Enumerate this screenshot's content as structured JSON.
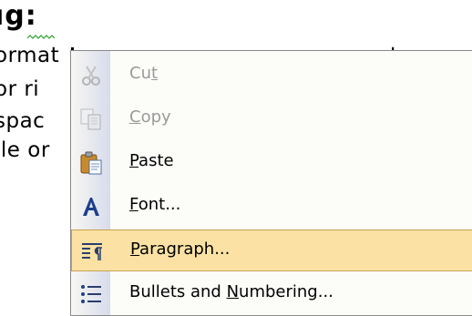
{
  "document": {
    "heading": "ıg:",
    "lines": [
      "ormat",
      "or ri",
      "spac",
      "jle or"
    ],
    "edge_glyphs": [
      "t",
      "v",
      "T",
      "I"
    ]
  },
  "context_menu": {
    "items": [
      {
        "label": "Cut",
        "mnemonic": "t",
        "icon": "scissors-icon",
        "enabled": false
      },
      {
        "label": "Copy",
        "mnemonic": "C",
        "icon": "copy-icon",
        "enabled": false
      },
      {
        "label": "Paste",
        "mnemonic": "P",
        "icon": "clipboard-paste-icon",
        "enabled": true
      },
      {
        "label": "Font...",
        "mnemonic": "F",
        "icon": "font-icon",
        "enabled": true
      },
      {
        "label": "Paragraph...",
        "mnemonic": "P",
        "icon": "paragraph-icon",
        "enabled": true,
        "highlighted": true
      },
      {
        "label": "Bullets and Numbering...",
        "mnemonic": "N",
        "icon": "bullets-icon",
        "enabled": true
      }
    ]
  },
  "colors": {
    "highlight_fill": "#fbe2a4",
    "highlight_border": "#c9a152",
    "disabled_text": "#9a9a9a",
    "menu_background": "#fcfcf9"
  }
}
